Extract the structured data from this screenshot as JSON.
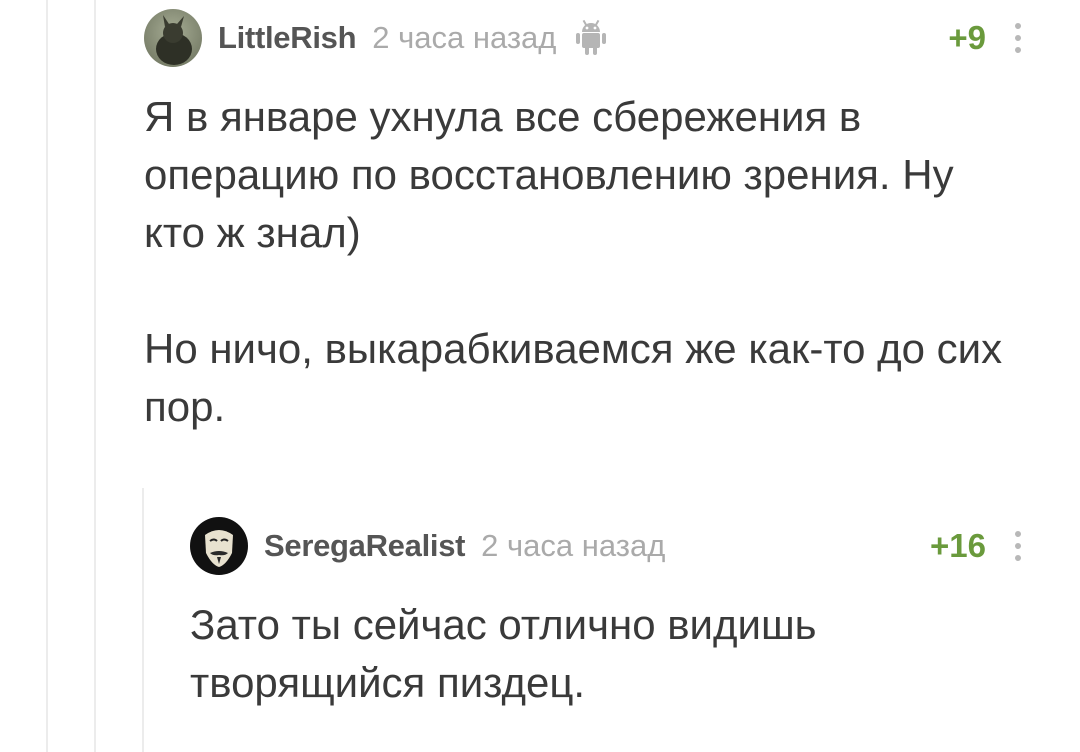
{
  "comments": [
    {
      "username": "LittleRish",
      "time": "2 часа назад",
      "device_icon": "android-icon",
      "rating": "+9",
      "paragraphs": [
        "Я в январе ухнула все сбережения в операцию по восстановлению зрения. Ну кто ж знал)",
        "Но ничо, выкарабкиваемся же как-то до сих пор."
      ]
    },
    {
      "username": "SeregaRealist",
      "time": "2 часа назад",
      "rating": "+16",
      "paragraphs": [
        "Зато ты сейчас отлично видишь творящийся пиздец."
      ]
    }
  ],
  "colors": {
    "rating": "#6a9a3c",
    "username": "#555555",
    "time": "#aaaaaa",
    "text": "#3a3a3a",
    "thread_line": "#ececec"
  }
}
